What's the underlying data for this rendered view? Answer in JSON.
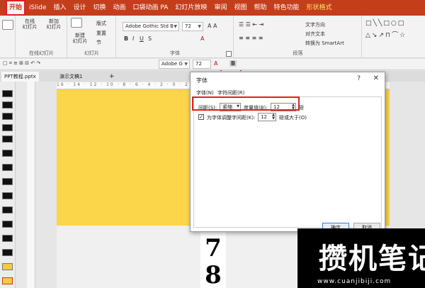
{
  "tabs": [
    "开始",
    "iSlide",
    "插入",
    "设计",
    "切换",
    "动画",
    "口袋动画 PA",
    "幻灯片放映",
    "审阅",
    "视图",
    "帮助",
    "特色功能",
    "形状格式"
  ],
  "ribbon": {
    "new_slide_live": "在线\n幻灯片",
    "new_slide_online": "新加\n幻灯片",
    "new_slide": "新建\n幻灯片",
    "layout": "版式",
    "reset": "重置",
    "section": "节",
    "group_online": "在线幻灯片",
    "group_slides": "幻灯片",
    "group_font": "字体",
    "group_paragraph": "段落",
    "font_name": "Adobe Gothic Std B",
    "font_size": "72",
    "text_direction": "文字方向",
    "align_text": "对齐文本",
    "smartart": "转换为 SmartArt"
  },
  "toolbar2": {
    "font_name": "Adobe G",
    "font_size": "72"
  },
  "doc_tabs": {
    "file1": "PPT教程.pptx",
    "file2": "演示文稿1"
  },
  "ruler_text": "16 · 14 · 12 · 10 · 8 · 6 · 4 · 2 · 0 · 2 · 4 · 6 · 8 · 10 · 12 · 14 · 16",
  "slide": {
    "numbers": [
      "7",
      "8"
    ]
  },
  "dialog": {
    "title": "字体",
    "help": "?",
    "close": "✕",
    "tab_font": "字体(N)",
    "tab_spacing": "字符间距(R)",
    "spacing_label": "间距(S):",
    "spacing_value": "紧缩",
    "measure_label": "度量值(B):",
    "measure_value": "12",
    "unit": "磅",
    "kerning_label": "为字体调整字间距(K):",
    "kerning_value": "12",
    "kerning_suffix": "磅或大于(O)",
    "ok": "确定",
    "cancel": "取消"
  },
  "watermark": {
    "text": "攒机笔记",
    "url": "www.cuanjibiji.com"
  }
}
